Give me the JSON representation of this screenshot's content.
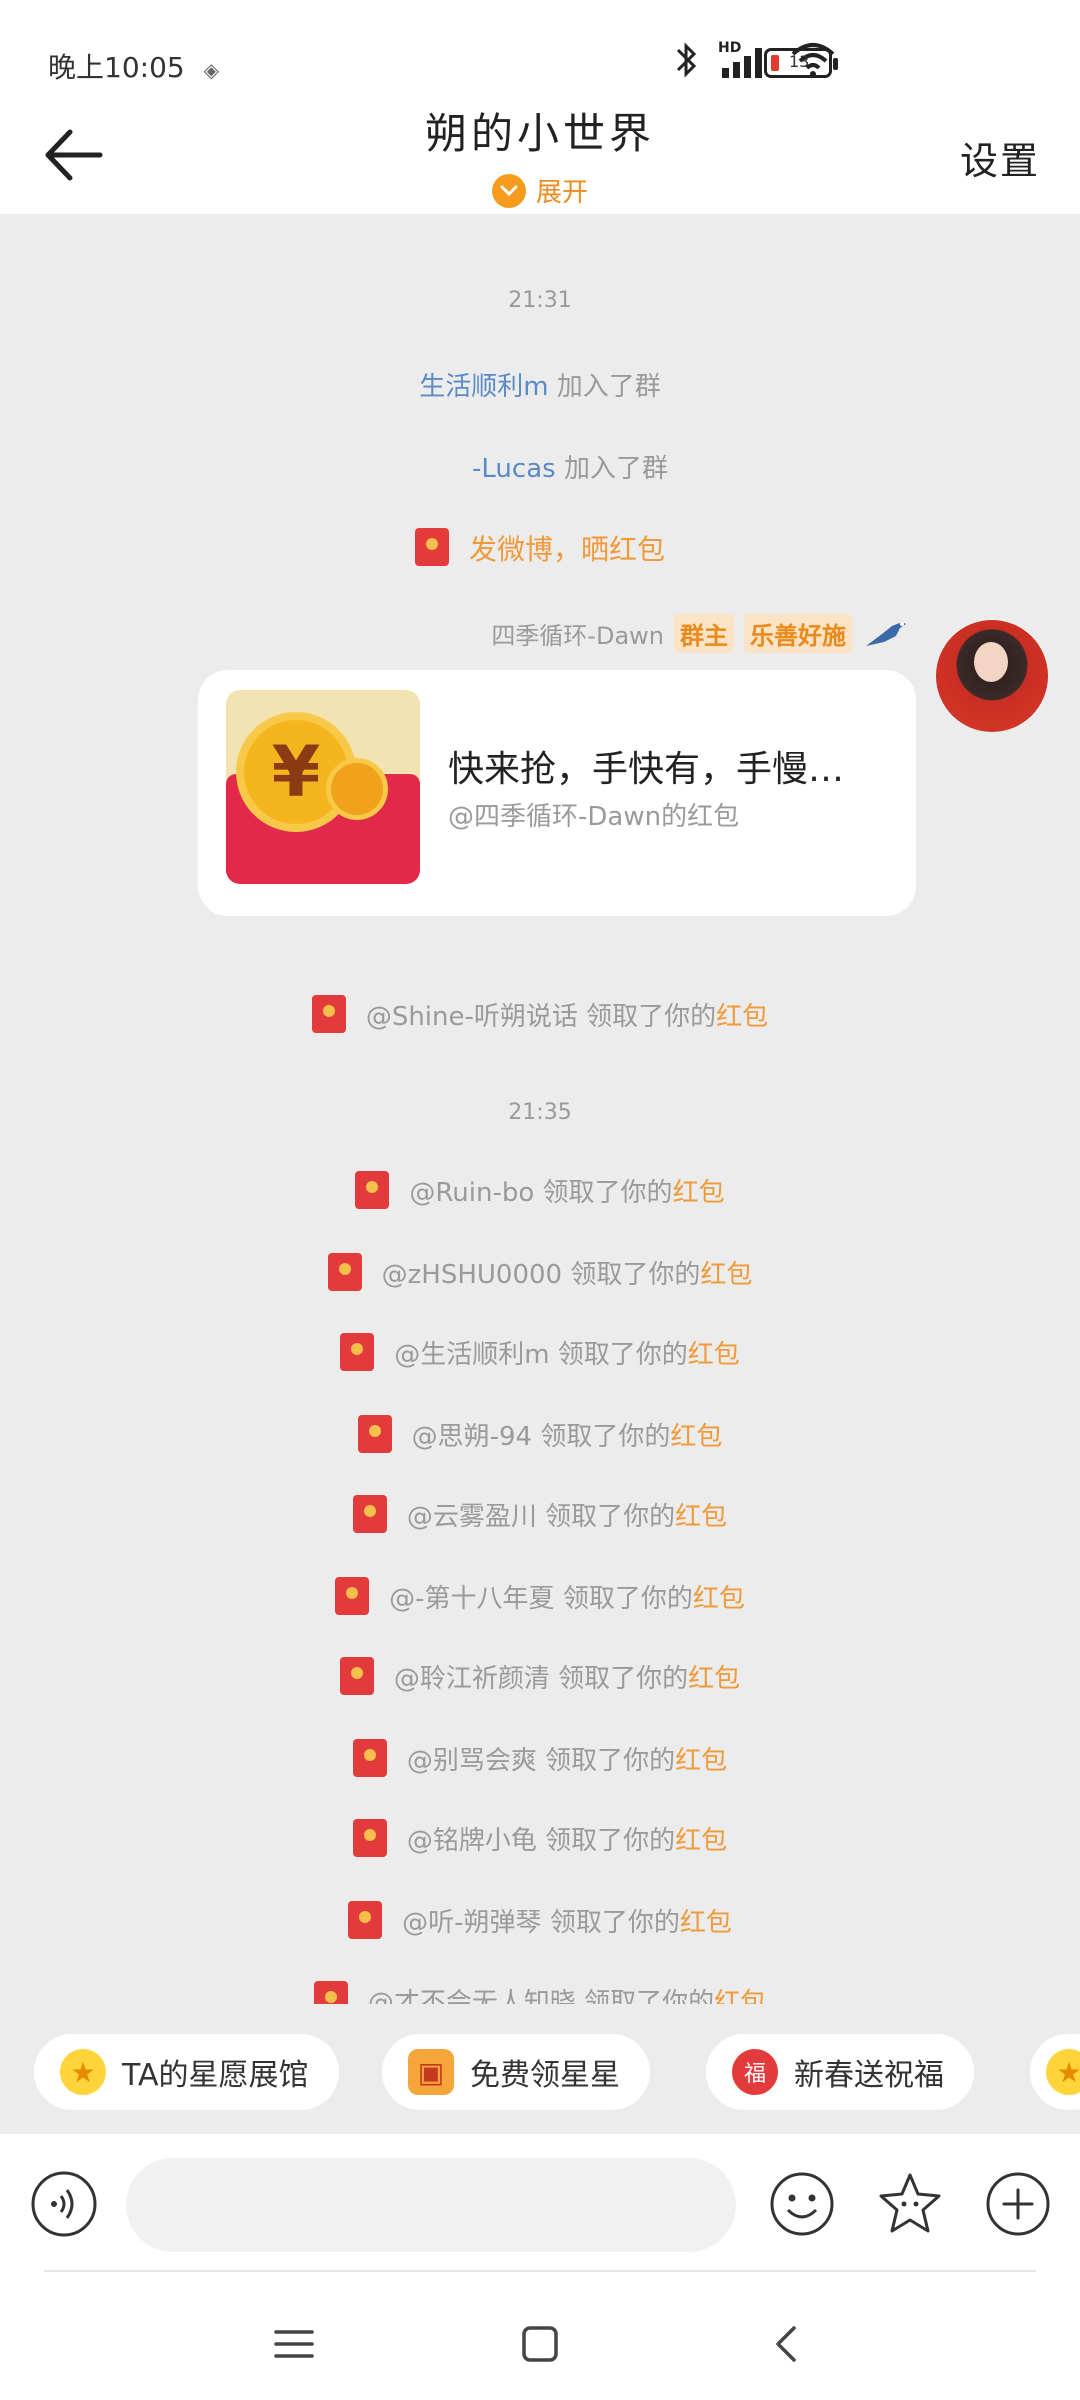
{
  "status": {
    "time": "晚上10:05",
    "battery_level": "13",
    "signal_label": "HD"
  },
  "header": {
    "title": "朔的小世界",
    "expand_label": "展开",
    "settings_label": "设置"
  },
  "chat": {
    "time1": "21:31",
    "join1_name": "生活顺利m",
    "join1_text": "加入了群",
    "join2_name": "-Lucas",
    "join2_text": "加入了群",
    "promo_text": "发微博，晒红包",
    "sender_name": "四季循环-Dawn",
    "tag_owner": "群主",
    "tag_charity": "乐善好施",
    "redpacket_title": "快来抢，手快有，手慢…",
    "redpacket_sub": "@四季循环-Dawn的红包",
    "claim_suffix": "红包",
    "claim_middle": "领取了你的",
    "time2": "21:35",
    "claims": [
      "@Shine-听朔说话",
      "@Ruin-bo",
      "@zHSHU0000",
      "@生活顺利m",
      "@思朔-94",
      "@云雾盈川",
      "@-第十八年夏",
      "@聆江祈颜清",
      "@别骂会爽",
      "@铭牌小龟",
      "@听-朔弹琴",
      "@才不会无人知晓"
    ]
  },
  "chips": [
    {
      "label": "TA的星愿展馆",
      "icon": "star-icon"
    },
    {
      "label": "免费领星星",
      "icon": "treasure-icon"
    },
    {
      "label": "新春送祝福",
      "icon": "fortune-icon"
    }
  ],
  "input": {
    "placeholder": ""
  },
  "colors": {
    "accent_orange": "#f09a3a",
    "name_blue": "#5b8bc7",
    "chat_bg": "#ececec",
    "redpacket_red": "#e2294a"
  }
}
